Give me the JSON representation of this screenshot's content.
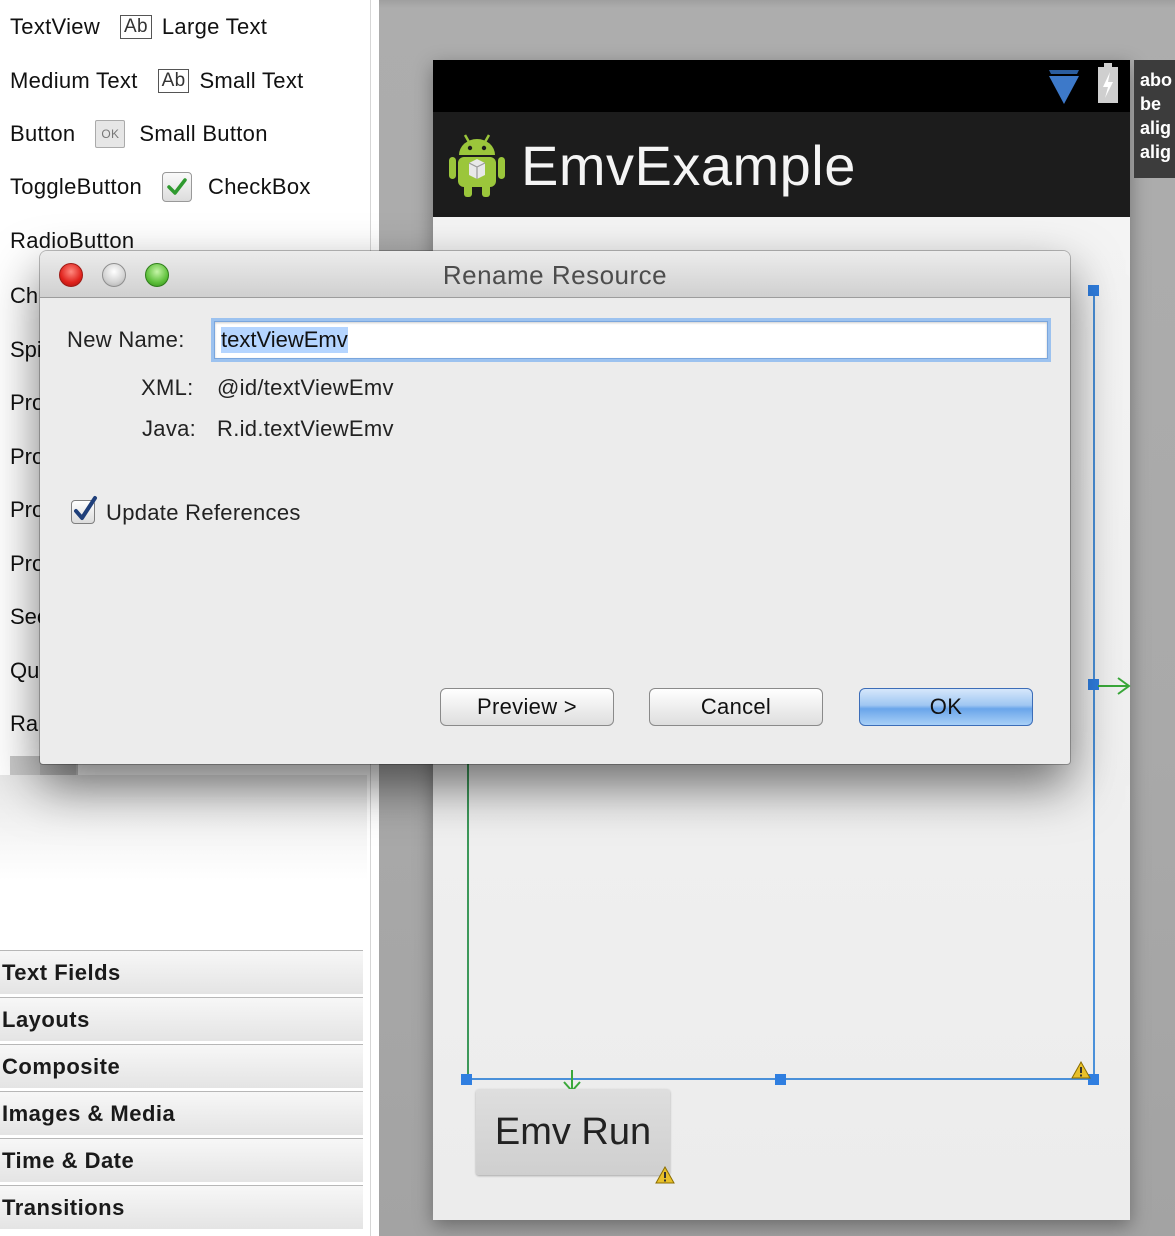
{
  "palette": {
    "rows": [
      {
        "a": "TextView",
        "b": "Large Text",
        "icon": "ab-icon"
      },
      {
        "a": "Medium Text",
        "b": "Small Text",
        "icon": "ab-icon"
      },
      {
        "a": "Button",
        "b": "Small Button",
        "icon": "ok-button-icon"
      },
      {
        "a": "ToggleButton",
        "b": "CheckBox",
        "icon": "checkbox-icon"
      },
      {
        "a": "RadioButton"
      }
    ],
    "ab_glyph": "Ab",
    "ok_glyph": "OK",
    "cut_rows": [
      "Ch",
      "Spi",
      "Pro",
      "Pro",
      "Pro",
      "Pro",
      "See",
      "Qu",
      "Ra"
    ],
    "categories": [
      "Text Fields",
      "Layouts",
      "Composite",
      "Images & Media",
      "Time & Date",
      "Transitions"
    ]
  },
  "device": {
    "app_title": "EmvExample",
    "button_label": "Emv Run",
    "tooltip_lines": [
      "abo",
      "be",
      "alig",
      "alig"
    ]
  },
  "dialog": {
    "title": "Rename Resource",
    "new_name_label": "New Name:",
    "new_name_value": "textViewEmv",
    "xml_label": "XML:",
    "xml_value": "@id/textViewEmv",
    "java_label": "Java:",
    "java_value": "R.id.textViewEmv",
    "update_references_label": "Update References",
    "update_references_checked": true,
    "buttons": {
      "preview": "Preview >",
      "cancel": "Cancel",
      "ok": "OK"
    }
  },
  "colors": {
    "accent": "#4a90d9",
    "default_button": "#6aa5ea",
    "warning": "#e8c02a"
  }
}
